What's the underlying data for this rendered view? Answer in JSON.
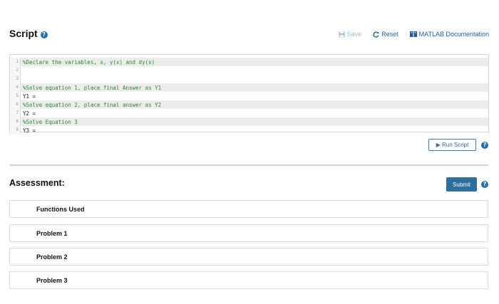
{
  "header": {
    "title": "Script",
    "help_icon": "question-circle-icon"
  },
  "toolbar": {
    "save_label": "Save",
    "reset_label": "Reset",
    "doc_label": "MATLAB Documentation",
    "save_icon": "floppy-disk-icon",
    "reset_icon": "refresh-icon",
    "doc_icon": "book-icon"
  },
  "editor": {
    "lines": [
      {
        "num": "1",
        "text": "%Declare the variables, x, y(x) and dy(x)",
        "kind": "comment",
        "shaded": true
      },
      {
        "num": "2",
        "text": "",
        "kind": "normal",
        "shaded": false
      },
      {
        "num": "3",
        "text": "",
        "kind": "normal",
        "shaded": false
      },
      {
        "num": "4",
        "text": "%Solve equation 1, place final Answer as Y1",
        "kind": "comment",
        "shaded": true
      },
      {
        "num": "5",
        "text": "Y1 =",
        "kind": "normal",
        "shaded": false
      },
      {
        "num": "6",
        "text": "%Solve equation 2, place final answer as Y2",
        "kind": "comment",
        "shaded": true
      },
      {
        "num": "7",
        "text": "Y2 =",
        "kind": "normal",
        "shaded": false
      },
      {
        "num": "8",
        "text": "%Solve Equation 3",
        "kind": "comment",
        "shaded": true
      },
      {
        "num": "9",
        "text": "Y3 =",
        "kind": "normal",
        "shaded": false
      }
    ]
  },
  "run": {
    "label": "▶ Run Script"
  },
  "assessment": {
    "title": "Assessment:",
    "submit_label": "Submit",
    "items": [
      {
        "label": "Functions Used"
      },
      {
        "label": "Problem 1"
      },
      {
        "label": "Problem 2"
      },
      {
        "label": "Problem 3"
      }
    ]
  },
  "colors": {
    "accent": "#1f6fb3",
    "submit_bg": "#2e6f9e",
    "comment": "#2b8a2b"
  }
}
